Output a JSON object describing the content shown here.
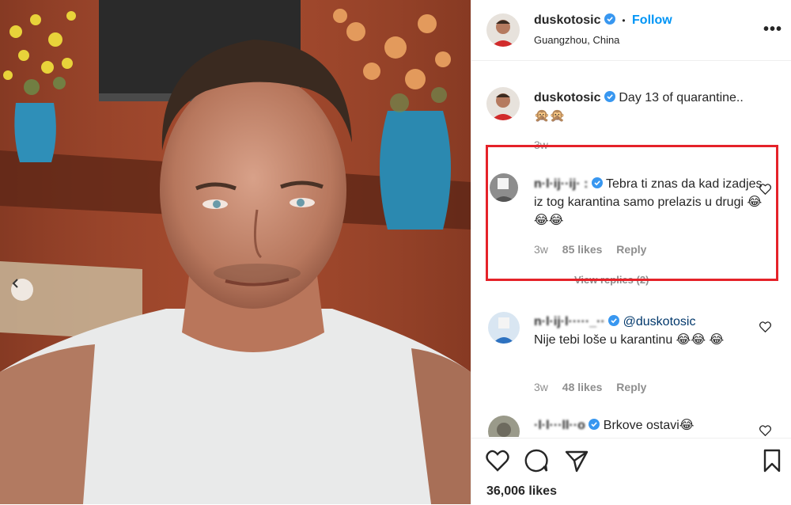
{
  "post": {
    "author": "duskotosic",
    "follow_label": "Follow",
    "location": "Guangzhou, China",
    "more_label": "•••",
    "caption": "Day 13 of quarantine..",
    "caption_emoji": "🙊🙊",
    "caption_time": "3w"
  },
  "comments": [
    {
      "username": "n·l·ij··ij· :",
      "text": "Tebra ti znas da kad izadjes iz tog karantina samo prelazis u drugi 😂😂😂",
      "time": "3w",
      "likes": "85 likes",
      "reply": "Reply",
      "view_replies": "View replies (2)"
    },
    {
      "username": "n·l·ij·l·····_·· ",
      "mention": "@duskotosic",
      "text": "Nije tebi loše u karantinu 😂😂 😂",
      "time": "3w",
      "likes": "48 likes",
      "reply": "Reply"
    },
    {
      "username": "·l·l···ll··o",
      "text": "Brkove ostavi😂"
    }
  ],
  "footer": {
    "likes_total": "36,006 likes"
  },
  "colors": {
    "accent": "#0095f6",
    "highlight": "#e52229",
    "muted": "#8e8e8e"
  }
}
